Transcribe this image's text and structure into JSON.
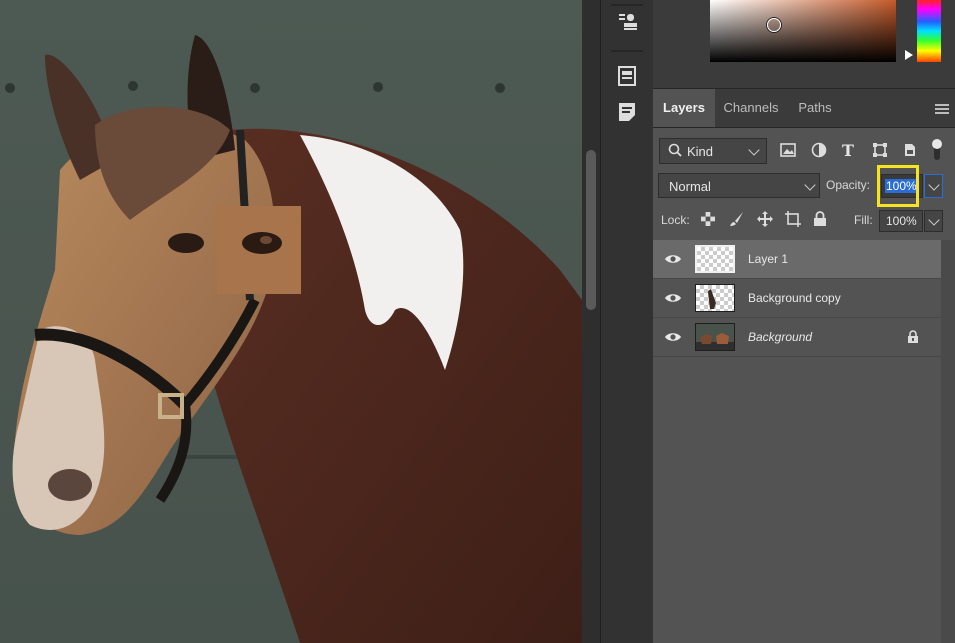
{
  "tabs": [
    {
      "label": "Layers",
      "active": true
    },
    {
      "label": "Channels",
      "active": false
    },
    {
      "label": "Paths",
      "active": false
    }
  ],
  "filter": {
    "kind_label": "Kind"
  },
  "blend": {
    "mode": "Normal",
    "opacity_label": "Opacity:",
    "opacity_value": "100%"
  },
  "lock": {
    "label": "Lock:",
    "fill_label": "Fill:",
    "fill_value": "100%"
  },
  "layers": [
    {
      "name": "Layer 1",
      "selected": true,
      "locked": false
    },
    {
      "name": "Background copy",
      "selected": false,
      "locked": false
    },
    {
      "name": "Background",
      "selected": false,
      "locked": true
    }
  ],
  "colors": {
    "highlight": "#f4e422",
    "panel_bg": "#535353",
    "selection_blue": "#2a6dd6"
  },
  "tool_icons": [
    "stamp-tool-icon",
    "properties-icon",
    "notes-icon"
  ]
}
